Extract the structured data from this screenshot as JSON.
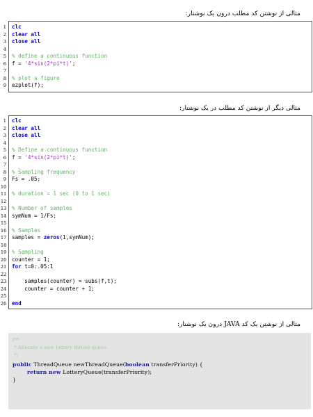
{
  "captions": {
    "first": "مثالی از نوشتن کد مطلب درون یک نوشتار:",
    "second": "مثالی دیگر از نوشتن کد مطلب در یک نوشتار:",
    "third": "مثالی از نوشتن یک کد JAVA درون یک نوشتار:"
  },
  "listing1": [
    {
      "n": "1",
      "segs": [
        {
          "t": "clc",
          "c": "kw"
        }
      ]
    },
    {
      "n": "2",
      "segs": [
        {
          "t": "clear all",
          "c": "kw"
        }
      ]
    },
    {
      "n": "3",
      "segs": [
        {
          "t": "close all",
          "c": "kw"
        }
      ]
    },
    {
      "n": "4",
      "segs": []
    },
    {
      "n": "5",
      "segs": [
        {
          "t": "% define a continuous function",
          "c": "cm"
        }
      ]
    },
    {
      "n": "6",
      "segs": [
        {
          "t": "f = ",
          "c": ""
        },
        {
          "t": "'4*sin(2*pi*t)'",
          "c": "st"
        },
        {
          "t": ";",
          "c": ""
        }
      ]
    },
    {
      "n": "7",
      "segs": []
    },
    {
      "n": "8",
      "segs": [
        {
          "t": "% plot a figure",
          "c": "cm"
        }
      ]
    },
    {
      "n": "9",
      "segs": [
        {
          "t": "ezplot(f);",
          "c": ""
        }
      ]
    }
  ],
  "listing2": [
    {
      "n": "1",
      "segs": [
        {
          "t": "clc",
          "c": "kw"
        }
      ]
    },
    {
      "n": "2",
      "segs": [
        {
          "t": "clear all",
          "c": "kw"
        }
      ]
    },
    {
      "n": "3",
      "segs": [
        {
          "t": "close all",
          "c": "kw"
        }
      ]
    },
    {
      "n": "4",
      "segs": []
    },
    {
      "n": "5",
      "segs": [
        {
          "t": "% Define a continuous function",
          "c": "cm"
        }
      ]
    },
    {
      "n": "6",
      "segs": [
        {
          "t": "f = ",
          "c": ""
        },
        {
          "t": "'4*sin(2*pi*t)'",
          "c": "st"
        },
        {
          "t": ";",
          "c": ""
        }
      ]
    },
    {
      "n": "7",
      "segs": []
    },
    {
      "n": "8",
      "segs": [
        {
          "t": "% Sampling frequency",
          "c": "cm"
        }
      ]
    },
    {
      "n": "9",
      "segs": [
        {
          "t": "Fs = .05;",
          "c": ""
        }
      ]
    },
    {
      "n": "10",
      "segs": []
    },
    {
      "n": "11",
      "segs": [
        {
          "t": "% duration = 1 sec (0 to 1 sec)",
          "c": "cm"
        }
      ]
    },
    {
      "n": "12",
      "segs": []
    },
    {
      "n": "13",
      "segs": [
        {
          "t": "% Number of samples",
          "c": "cm"
        }
      ]
    },
    {
      "n": "14",
      "segs": [
        {
          "t": "symNum = 1/Fs;",
          "c": ""
        }
      ]
    },
    {
      "n": "15",
      "segs": []
    },
    {
      "n": "16",
      "segs": [
        {
          "t": "% Samples",
          "c": "cm"
        }
      ]
    },
    {
      "n": "17",
      "segs": [
        {
          "t": "samples = ",
          "c": ""
        },
        {
          "t": "zeros",
          "c": "kw"
        },
        {
          "t": "(1,symNum);",
          "c": ""
        }
      ]
    },
    {
      "n": "18",
      "segs": []
    },
    {
      "n": "19",
      "segs": [
        {
          "t": "% Sampling",
          "c": "cm"
        }
      ]
    },
    {
      "n": "20",
      "segs": [
        {
          "t": "counter = 1;",
          "c": ""
        }
      ]
    },
    {
      "n": "21",
      "segs": [
        {
          "t": "for",
          "c": "kw"
        },
        {
          "t": " t=0:.05:1",
          "c": ""
        }
      ]
    },
    {
      "n": "22",
      "segs": []
    },
    {
      "n": "23",
      "segs": [
        {
          "t": "    samples(counter) = subs(f,t);",
          "c": ""
        }
      ]
    },
    {
      "n": "24",
      "segs": [
        {
          "t": "    counter = counter + 1;",
          "c": ""
        }
      ]
    },
    {
      "n": "25",
      "segs": []
    },
    {
      "n": "26",
      "segs": [
        {
          "t": "end",
          "c": "kw"
        }
      ]
    }
  ],
  "java": [
    {
      "segs": [
        {
          "t": "/**",
          "c": "jcm"
        }
      ]
    },
    {
      "segs": [
        {
          "t": " * Allocate a new lottery thread queue.",
          "c": "jcm"
        }
      ]
    },
    {
      "segs": [
        {
          "t": " */",
          "c": "jcm"
        }
      ]
    },
    {
      "segs": [
        {
          "t": "public",
          "c": "jkw"
        },
        {
          "t": " ThreadQueue newThreadQueue(",
          "c": ""
        },
        {
          "t": "boolean",
          "c": "jkw"
        },
        {
          "t": " transferPriority) {",
          "c": ""
        }
      ]
    },
    {
      "segs": [
        {
          "t": "        ",
          "c": ""
        },
        {
          "t": "return",
          "c": "jkw"
        },
        {
          "t": " ",
          "c": ""
        },
        {
          "t": "new",
          "c": "jkw"
        },
        {
          "t": " LotteryQueue(transferPriority);",
          "c": ""
        }
      ]
    },
    {
      "segs": [
        {
          "t": "}",
          "c": ""
        }
      ]
    }
  ]
}
